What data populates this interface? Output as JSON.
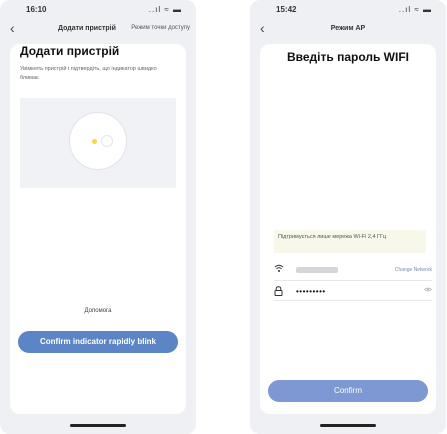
{
  "left_screen": {
    "status": {
      "time": "16:10",
      "icons": "..ıl ≈ ▬"
    },
    "nav": {
      "title": "Додати пристрій",
      "action": "Режим точки доступу"
    },
    "title": "Додати пристрій",
    "description": "Увімкніть пристрій і підтвердіть, що індикатор швидко блимає",
    "help_link": "Допомога",
    "button_label": "Confirm indicator rapidly blink"
  },
  "right_screen": {
    "status": {
      "time": "15:42",
      "icons": "..ıl ≈ ▬"
    },
    "nav": {
      "title": "Режим AP"
    },
    "title": "Введіть пароль WIFI",
    "note": "Підтримується лише мережа Wi-Fi 2,4 ГГц",
    "change_network": "Change Network",
    "password_value": "•••••••••",
    "confirm_label": "Confirm"
  }
}
